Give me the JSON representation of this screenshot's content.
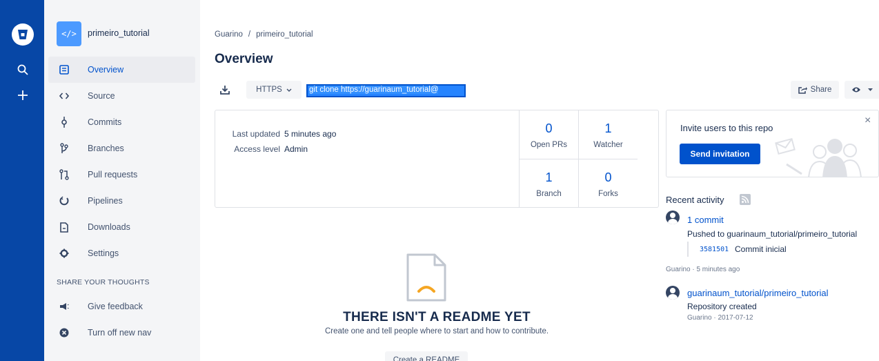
{
  "project": {
    "name": "primeiro_tutorial",
    "avatar_glyph": "</>"
  },
  "sidebar": {
    "items": [
      {
        "label": "Overview",
        "icon": "overview-icon"
      },
      {
        "label": "Source",
        "icon": "code-icon"
      },
      {
        "label": "Commits",
        "icon": "commit-icon"
      },
      {
        "label": "Branches",
        "icon": "branch-icon"
      },
      {
        "label": "Pull requests",
        "icon": "pull-request-icon"
      },
      {
        "label": "Pipelines",
        "icon": "pipelines-icon"
      },
      {
        "label": "Downloads",
        "icon": "downloads-icon"
      },
      {
        "label": "Settings",
        "icon": "gear-icon"
      }
    ],
    "section_title": "SHARE YOUR THOUGHTS",
    "feedback": [
      {
        "label": "Give feedback",
        "icon": "megaphone-icon"
      },
      {
        "label": "Turn off new nav",
        "icon": "close-circle-icon"
      }
    ]
  },
  "breadcrumb": {
    "owner": "Guarino",
    "separator": "/",
    "repo": "primeiro_tutorial"
  },
  "page_title": "Overview",
  "clone": {
    "protocol": "HTTPS",
    "command": "git clone https://guarinaum_tutorial@"
  },
  "actions": {
    "share_label": "Share"
  },
  "info": {
    "last_updated_label": "Last updated",
    "last_updated_value": "5 minutes ago",
    "access_label": "Access level",
    "access_value": "Admin"
  },
  "stats": [
    {
      "value": "0",
      "label": "Open PRs"
    },
    {
      "value": "1",
      "label": "Watcher"
    },
    {
      "value": "1",
      "label": "Branch"
    },
    {
      "value": "0",
      "label": "Forks"
    }
  ],
  "invite": {
    "title": "Invite users to this repo",
    "button": "Send invitation",
    "close": "×"
  },
  "recent_activity": {
    "title": "Recent activity",
    "items": [
      {
        "link": "1 commit",
        "desc": "Pushed to guarinaum_tutorial/primeiro_tutorial",
        "commit_hash": "3581501",
        "commit_msg": "Commit inicial",
        "meta": "Guarino · 5 minutes ago"
      },
      {
        "link": "guarinaum_tutorial/primeiro_tutorial",
        "desc": "Repository created",
        "meta": "Guarino · 2017-07-12"
      }
    ]
  },
  "readme": {
    "title": "THERE ISN'T A README YET",
    "subtitle": "Create one and tell people where to start and how to contribute.",
    "button": "Create a README"
  },
  "colors": {
    "global_nav": "#0747a6",
    "primary": "#0052cc",
    "sidebar_bg": "#f4f5f7"
  }
}
